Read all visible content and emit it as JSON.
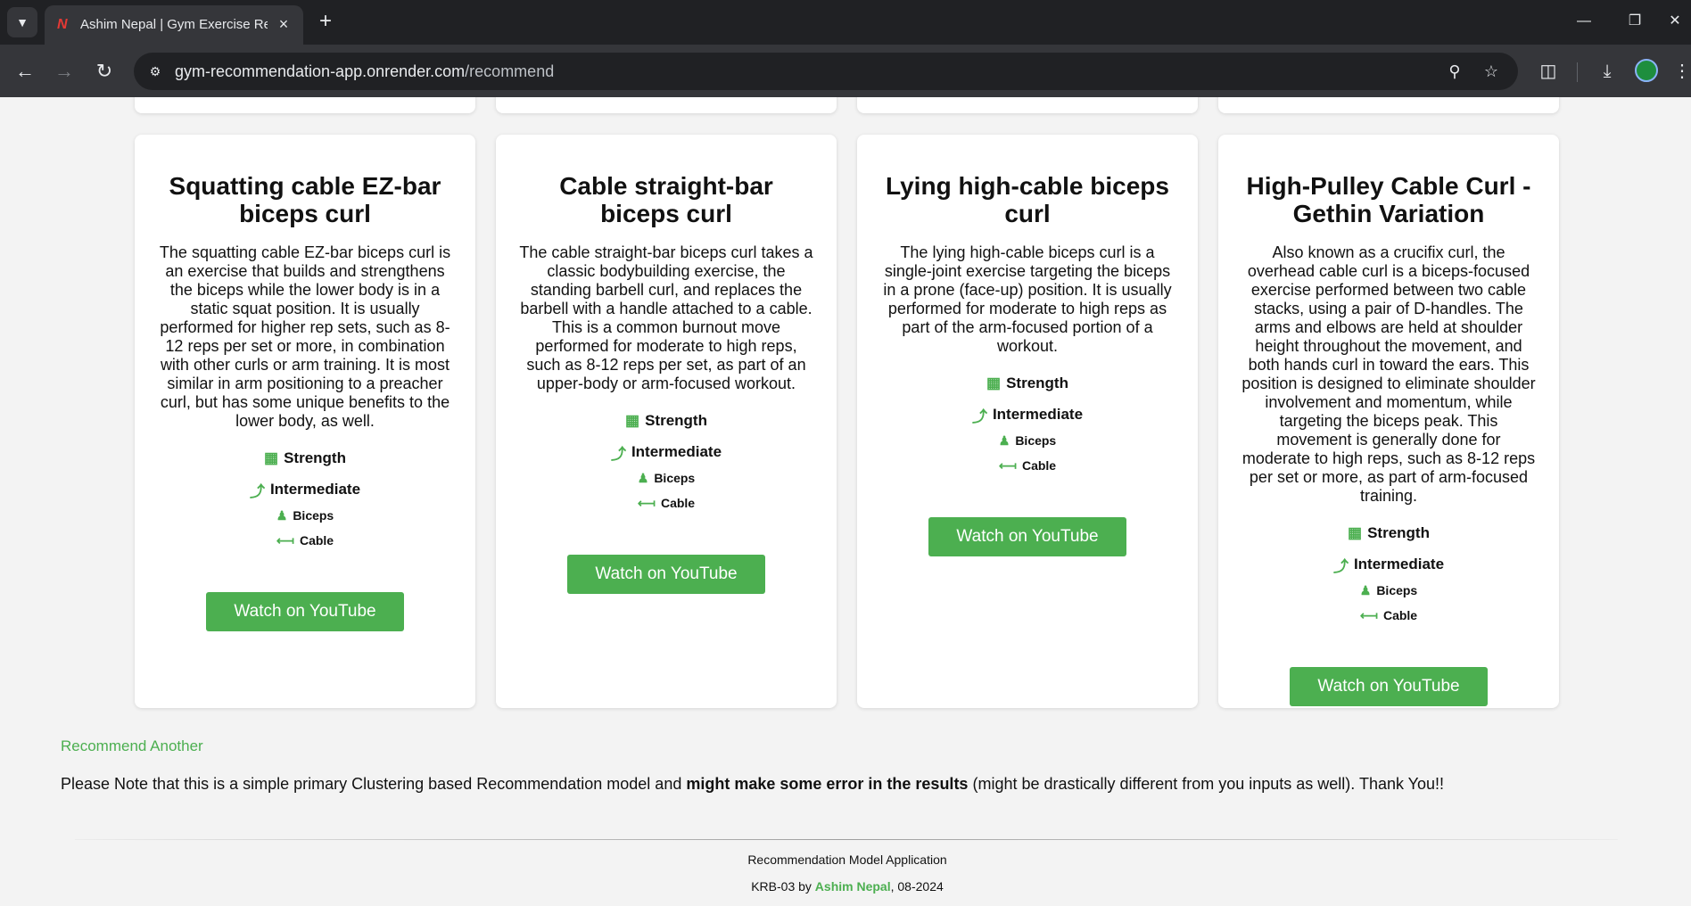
{
  "browser": {
    "tab_title": "Ashim Nepal | Gym Exercise Rec",
    "url_host": "gym-recommendation-app.onrender.com",
    "url_path": "/recommend"
  },
  "cards": [
    {
      "title": "Squatting cable EZ-bar biceps curl",
      "description": "The squatting cable EZ-bar biceps curl is an exercise that builds and strengthens the biceps while the lower body is in a static squat position. It is usually performed for higher rep sets, such as 8-12 reps per set or more, in combination with other curls or arm training. It is most similar in arm positioning to a preacher curl, but has some unique benefits to the lower body, as well.",
      "type": "Strength",
      "level": "Intermediate",
      "muscle": "Biceps",
      "equipment": "Cable",
      "button": "Watch on YouTube"
    },
    {
      "title": "Cable straight-bar biceps curl",
      "description": "The cable straight-bar biceps curl takes a classic bodybuilding exercise, the standing barbell curl, and replaces the barbell with a handle attached to a cable. This is a common burnout move performed for moderate to high reps, such as 8-12 reps per set, as part of an upper-body or arm-focused workout.",
      "type": "Strength",
      "level": "Intermediate",
      "muscle": "Biceps",
      "equipment": "Cable",
      "button": "Watch on YouTube"
    },
    {
      "title": "Lying high-cable biceps curl",
      "description": "The lying high-cable biceps curl is a single-joint exercise targeting the biceps in a prone (face-up) position. It is usually performed for moderate to high reps as part of the arm-focused portion of a workout.",
      "type": "Strength",
      "level": "Intermediate",
      "muscle": "Biceps",
      "equipment": "Cable",
      "button": "Watch on YouTube"
    },
    {
      "title": "High-Pulley Cable Curl - Gethin Variation",
      "description": "Also known as a crucifix curl, the overhead cable curl is a biceps-focused exercise performed between two cable stacks, using a pair of D-handles. The arms and elbows are held at shoulder height throughout the movement, and both hands curl in toward the ears. This position is designed to eliminate shoulder involvement and momentum, while targeting the biceps peak. This movement is generally done for moderate to high reps, such as 8-12 reps per set or more, as part of arm-focused training.",
      "type": "Strength",
      "level": "Intermediate",
      "muscle": "Biceps",
      "equipment": "Cable",
      "button": "Watch on YouTube"
    }
  ],
  "recommend_another": "Recommend Another",
  "note": {
    "before": "Please Note that this is a simple primary Clustering based Recommendation model and ",
    "bold": "might make some error in the results",
    "after": " (might be drastically different from you inputs as well). Thank You!!"
  },
  "footer": {
    "app_name": "Recommendation Model Application",
    "prefix": "KRB-03 by ",
    "author": "Ashim Nepal",
    "suffix": ", 08-2024"
  },
  "colors": {
    "accent": "#4caf50"
  }
}
